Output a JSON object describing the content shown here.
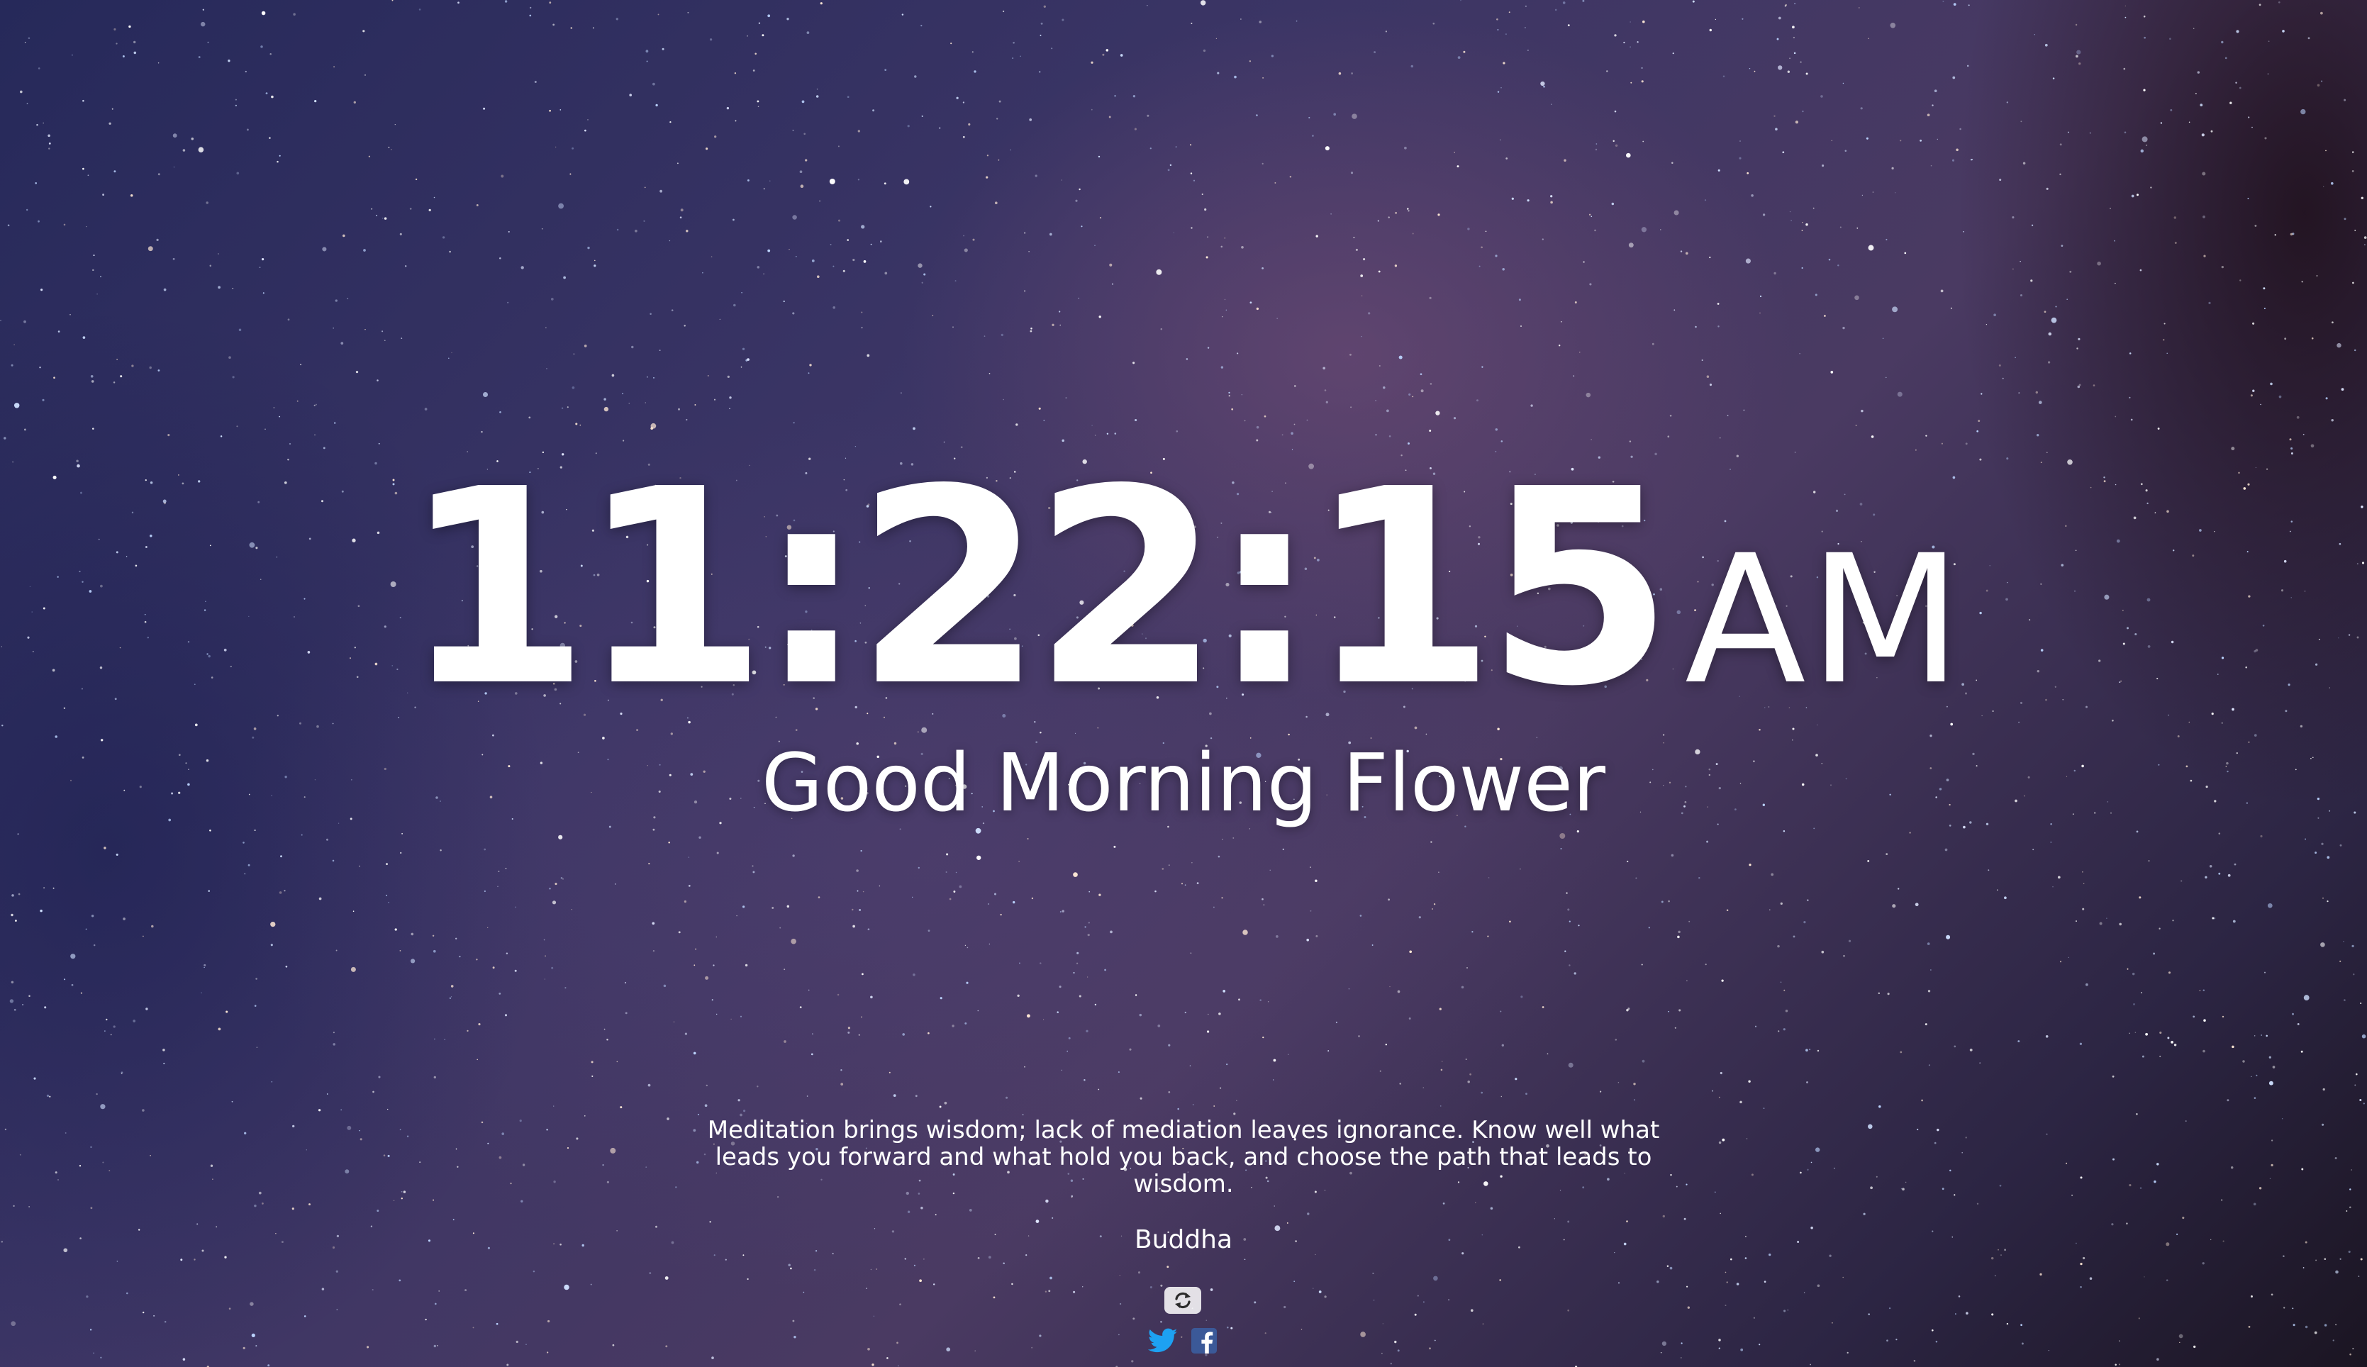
{
  "clock": {
    "time": "11:22:15",
    "period": "AM"
  },
  "greeting": "Good Morning Flower",
  "quote": {
    "text": "Meditation brings wisdom; lack of mediation leaves ignorance. Know well what leads you forward and what hold you back, and choose the path that leads to wisdom.",
    "author": "Buddha"
  },
  "controls": {
    "refresh_icon": "refresh-icon",
    "share": [
      {
        "icon": "twitter-icon",
        "color": "#1da1f2"
      },
      {
        "icon": "facebook-icon",
        "color": "#3b5998"
      }
    ]
  },
  "background": {
    "theme": "starry night sky",
    "colors": [
      "#26295a",
      "#4a3a62",
      "#1b1522"
    ]
  }
}
